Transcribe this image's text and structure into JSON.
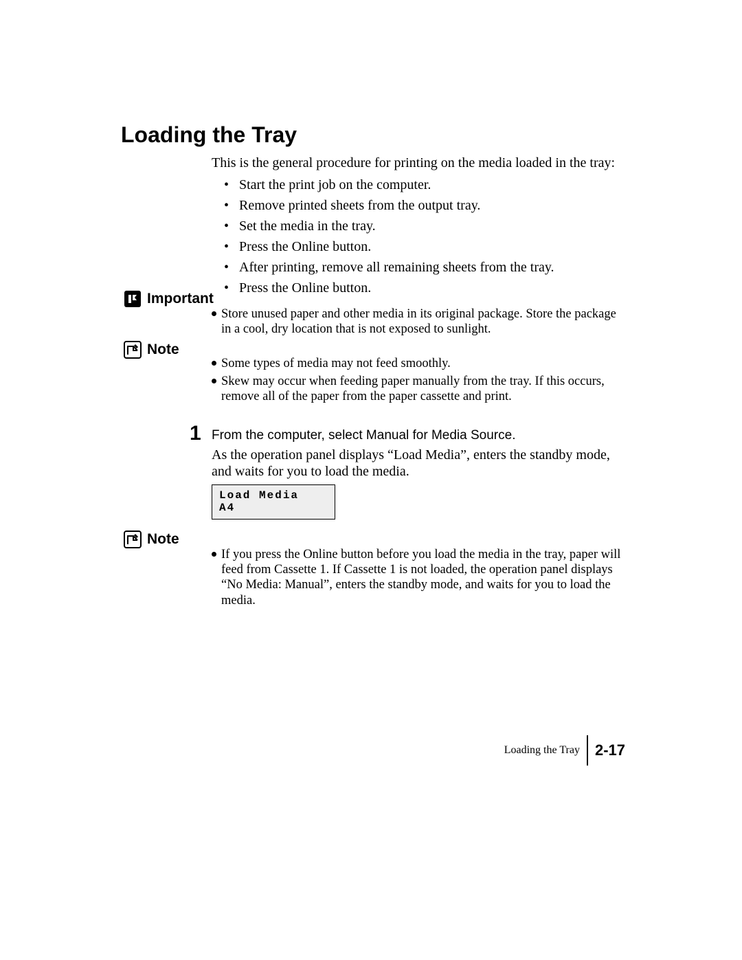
{
  "heading": "Loading the Tray",
  "intro": "This is the general procedure for printing on the media loaded in the tray:",
  "bullets": [
    "Start the print job on the computer.",
    "Remove printed sheets from the output tray.",
    "Set the media in the tray.",
    "Press the Online button.",
    "After printing, remove all remaining sheets from the tray.",
    "Press the Online button."
  ],
  "important": {
    "label": "Important",
    "items": [
      "Store unused paper and other media in its original package. Store the package in a cool, dry location that is not exposed to sunlight."
    ]
  },
  "note1": {
    "label": "Note",
    "items": [
      "Some types of media may not feed smoothly.",
      "Skew may occur when feeding paper manually from the tray. If this occurs, remove all of the paper from the paper cassette and print."
    ]
  },
  "step": {
    "number": "1",
    "title": "From the computer, select Manual for Media Source.",
    "body": "As the operation panel displays “Load Media”, enters the standby mode, and waits for you to load the media."
  },
  "lcd": "Load Media\nA4",
  "note2": {
    "label": "Note",
    "items": [
      "If you press the Online button before you load the media in the tray, paper will feed from Cassette 1. If Cassette 1 is not loaded, the operation panel displays “No Media: Manual”, enters the standby mode, and waits for you to load the media."
    ]
  },
  "footer": {
    "title": "Loading the Tray",
    "page": "2-17"
  }
}
